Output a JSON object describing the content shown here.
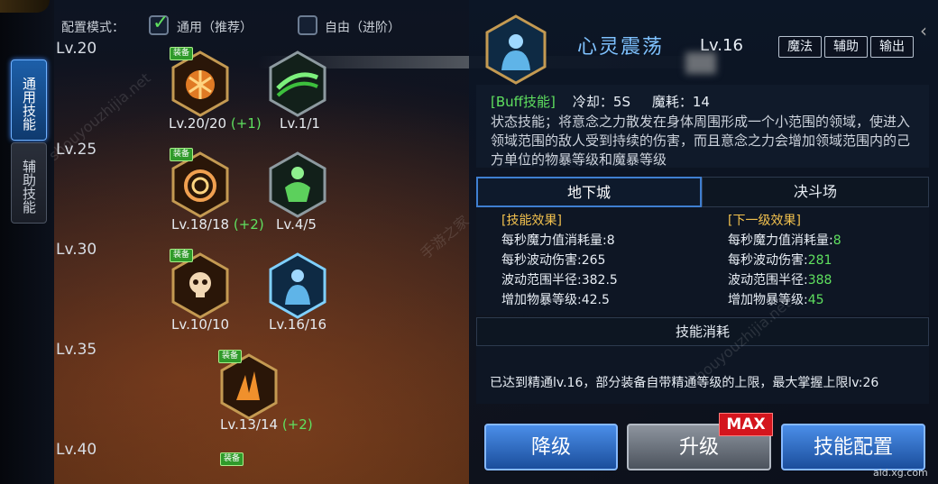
{
  "tabs": [
    {
      "label": "通用技能"
    },
    {
      "label": "辅助技能"
    }
  ],
  "mode": {
    "label": "配置模式：",
    "options": [
      {
        "label": "通用（推荐）",
        "checked": true
      },
      {
        "label": "自由（进阶）",
        "checked": false
      }
    ]
  },
  "levels": [
    "Lv.20",
    "Lv.25",
    "Lv.30",
    "Lv.35",
    "Lv.40"
  ],
  "equip_tag": "装备",
  "skills": [
    {
      "level": "Lv.20/20",
      "bonus": "(+1)",
      "equipped": true,
      "icon": "fire-burst-icon"
    },
    {
      "level": "Lv.1/1",
      "bonus": "",
      "equipped": false,
      "icon": "green-wave-icon"
    },
    {
      "level": "Lv.18/18",
      "bonus": "(+2)",
      "equipped": true,
      "icon": "orange-swirl-icon"
    },
    {
      "level": "Lv.4/5",
      "bonus": "",
      "equipped": false,
      "icon": "green-muscle-icon"
    },
    {
      "level": "Lv.10/10",
      "bonus": "",
      "equipped": true,
      "icon": "skull-icon"
    },
    {
      "level": "Lv.16/16",
      "bonus": "",
      "equipped": false,
      "icon": "psychic-figure-icon"
    },
    {
      "level": "Lv.13/14",
      "bonus": "(+2)",
      "equipped": true,
      "icon": "fire-claw-icon"
    }
  ],
  "detail": {
    "name": "心灵震荡",
    "level": "Lv.16",
    "tags": [
      "魔法",
      "辅助",
      "输出"
    ],
    "type": "[Buff技能]",
    "cooldown": "冷却：5S",
    "mana": "魔耗：14",
    "description": "状态技能；将意念之力散发在身体周围形成一个小范围的领域，使进入领域范围的敌人受到持续的伤害，而且意念之力会增加领域范围内的己方单位的物暴等级和魔暴等级"
  },
  "pv_tabs": [
    "地下城",
    "决斗场"
  ],
  "effects": {
    "current_title": "[技能效果]",
    "next_title": "[下一级效果]",
    "current": [
      {
        "label": "每秒魔力值消耗量:",
        "value": "8"
      },
      {
        "label": "每秒波动伤害:",
        "value": "265"
      },
      {
        "label": "波动范围半径:",
        "value": "382.5"
      },
      {
        "label": "增加物暴等级:",
        "value": "42.5"
      }
    ],
    "next": [
      {
        "label": "每秒魔力值消耗量:",
        "value": "8"
      },
      {
        "label": "每秒波动伤害:",
        "value": "281"
      },
      {
        "label": "波动范围半径:",
        "value": "388"
      },
      {
        "label": "增加物暴等级:",
        "value": "45"
      }
    ]
  },
  "cost": {
    "title": "技能消耗",
    "text": "已达到精通lv.16，部分装备自带精通等级的上限，最大掌握上限lv:26"
  },
  "buttons": {
    "downgrade": "降级",
    "upgrade": "升级",
    "max": "MAX",
    "config": "技能配置"
  },
  "watermarks": [
    "shouyouzhijia.net",
    "手游之家",
    "shouyouzhijia.net"
  ],
  "footer": "ald.xg.com",
  "colors": {
    "accent": "#7fc2ff",
    "green": "#5fe05f",
    "gold": "#f2c14e",
    "max": "#d4151d"
  }
}
